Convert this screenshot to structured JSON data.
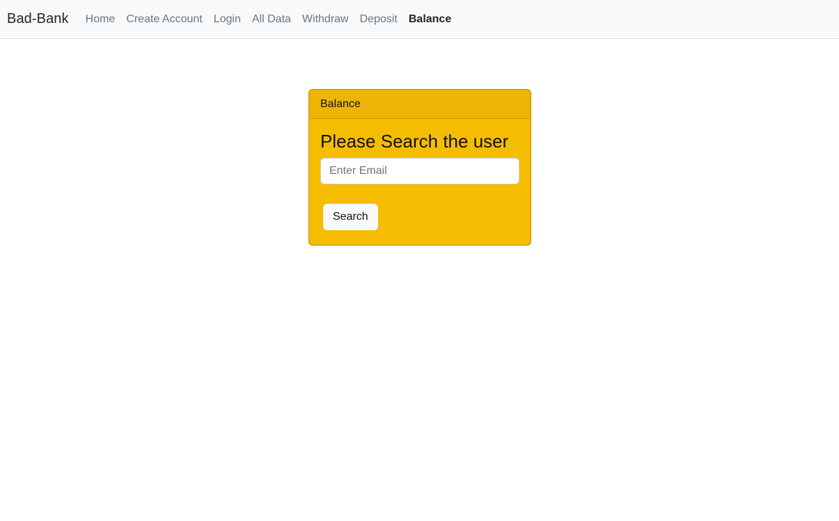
{
  "navbar": {
    "brand": "Bad-Bank",
    "links": [
      {
        "label": "Home",
        "active": false
      },
      {
        "label": "Create Account",
        "active": false
      },
      {
        "label": "Login",
        "active": false
      },
      {
        "label": "All Data",
        "active": false
      },
      {
        "label": "Withdraw",
        "active": false
      },
      {
        "label": "Deposit",
        "active": false
      },
      {
        "label": "Balance",
        "active": true
      }
    ]
  },
  "card": {
    "header": "Balance",
    "title": "Please Search the user",
    "email_placeholder": "Enter Email",
    "email_value": "",
    "search_label": "Search"
  },
  "colors": {
    "card_background": "#f5bd02",
    "card_header_background": "#edb503",
    "navbar_background": "#f8f9fa"
  }
}
